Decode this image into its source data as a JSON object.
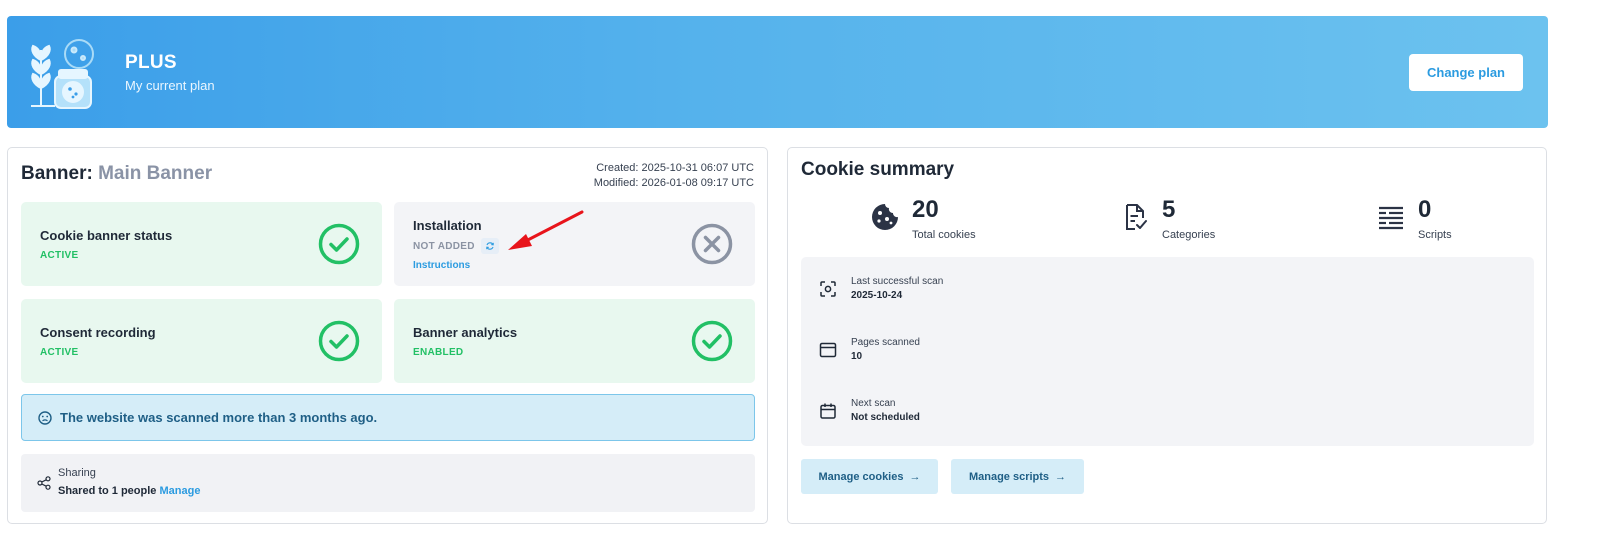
{
  "plan": {
    "name": "PLUS",
    "subtitle": "My current plan",
    "change_button": "Change plan"
  },
  "banner": {
    "heading_prefix": "Banner:",
    "name": "Main Banner",
    "created": "Created: 2025-10-31 06:07 UTC",
    "modified": "Modified: 2026-01-08 09:17 UTC",
    "tiles": {
      "cookie_status": {
        "title": "Cookie banner status",
        "status": "ACTIVE",
        "icon": "check-circle-icon"
      },
      "installation": {
        "title": "Installation",
        "status": "NOT ADDED",
        "link": "Instructions",
        "icon": "x-circle-icon"
      },
      "consent": {
        "title": "Consent recording",
        "status": "ACTIVE",
        "icon": "check-circle-icon"
      },
      "analytics": {
        "title": "Banner analytics",
        "status": "ENABLED",
        "icon": "check-circle-icon"
      }
    },
    "alert": "The website was scanned more than 3 months ago.",
    "sharing": {
      "label": "Sharing",
      "text": "Shared to 1 people",
      "manage": "Manage"
    }
  },
  "summary": {
    "title": "Cookie summary",
    "stats": [
      {
        "value": "20",
        "label": "Total cookies",
        "icon": "cookie-icon"
      },
      {
        "value": "5",
        "label": "Categories",
        "icon": "document-check-icon"
      },
      {
        "value": "0",
        "label": "Scripts",
        "icon": "list-icon"
      }
    ],
    "scan": {
      "last": {
        "label": "Last successful scan",
        "value": "2025-10-24"
      },
      "pages": {
        "label": "Pages scanned",
        "value": "10"
      },
      "next": {
        "label": "Next scan",
        "value": "Not scheduled"
      }
    },
    "buttons": {
      "cookies": "Manage cookies",
      "scripts": "Manage scripts"
    }
  },
  "colors": {
    "accent": "#2b9be0",
    "success": "#22c065",
    "muted": "#8b93a3",
    "annotation_arrow": "#e8141b"
  }
}
